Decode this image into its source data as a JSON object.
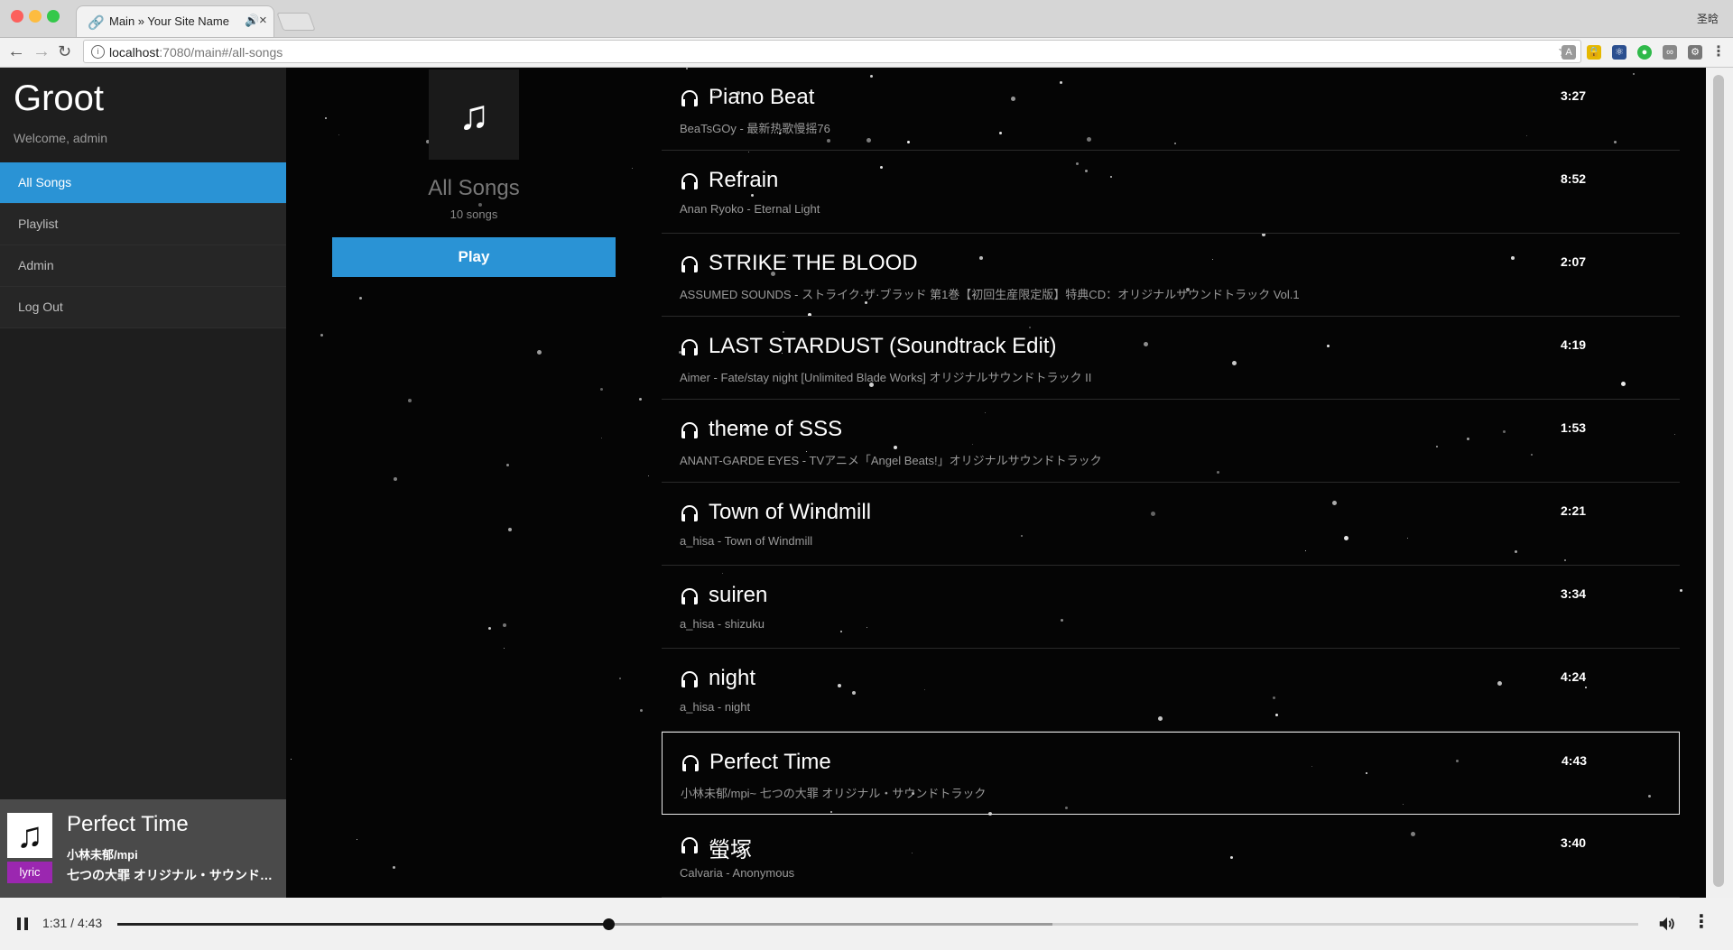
{
  "browser": {
    "tab_title": "Main » Your Site Name",
    "profile_name": "圣晗",
    "url_host": "localhost",
    "url_rest": ":7080/main#/all-songs"
  },
  "sidebar": {
    "brand": "Groot",
    "welcome": "Welcome, admin",
    "items": [
      {
        "label": "All Songs",
        "active": true
      },
      {
        "label": "Playlist",
        "active": false
      },
      {
        "label": "Admin",
        "active": false
      },
      {
        "label": "Log Out",
        "active": false
      }
    ]
  },
  "now_playing": {
    "title": "Perfect Time",
    "artist": "小林未郁/mpi",
    "album": "七つの大罪 オリジナル・サウンドトラック",
    "lyric_label": "lyric"
  },
  "playlist": {
    "title": "All Songs",
    "count": "10 songs",
    "play_label": "Play"
  },
  "songs": [
    {
      "title": "Piano Beat",
      "meta": "BeaTsGOy - 最新热歌慢摇76",
      "duration": "3:27"
    },
    {
      "title": "Refrain",
      "meta": "Anan Ryoko - Eternal Light",
      "duration": "8:52"
    },
    {
      "title": "STRIKE THE BLOOD",
      "meta": "ASSUMED SOUNDS - ストライク·ザ·ブラッド 第1巻【初回生産限定版】特典CD：オリジナルサウンドトラック Vol.1",
      "duration": "2:07"
    },
    {
      "title": "LAST STARDUST (Soundtrack Edit)",
      "meta": "Aimer - Fate/stay night [Unlimited Blade Works] オリジナルサウンドトラック II",
      "duration": "4:19"
    },
    {
      "title": "theme of SSS",
      "meta": "ANANT-GARDE EYES - TVアニメ「Angel Beats!」オリジナルサウンドトラック",
      "duration": "1:53"
    },
    {
      "title": "Town of Windmill",
      "meta": "a_hisa - Town of Windmill",
      "duration": "2:21"
    },
    {
      "title": "suiren",
      "meta": "a_hisa - shizuku",
      "duration": "3:34"
    },
    {
      "title": "night",
      "meta": "a_hisa - night",
      "duration": "4:24"
    },
    {
      "title": "Perfect Time",
      "meta": "小林未郁/mpi~ 七つの大罪 オリジナル・サウンドトラック",
      "duration": "4:43",
      "selected": true
    },
    {
      "title": "螢塚",
      "meta": "Calvaria - Anonymous",
      "duration": "3:40"
    }
  ],
  "player": {
    "time": "1:31 / 4:43",
    "progress": 0.323,
    "buffered": 0.615
  },
  "colors": {
    "accent": "#2a93d5",
    "lyric_badge": "#9b27b0",
    "sidebar_bg": "#1e1e1e",
    "page_bg": "#050505"
  },
  "icons": {
    "song": "headphones-icon",
    "cover": "music-note-icon",
    "pause": "pause-icon",
    "volume": "volume-icon",
    "more": "more-vert-icon"
  }
}
